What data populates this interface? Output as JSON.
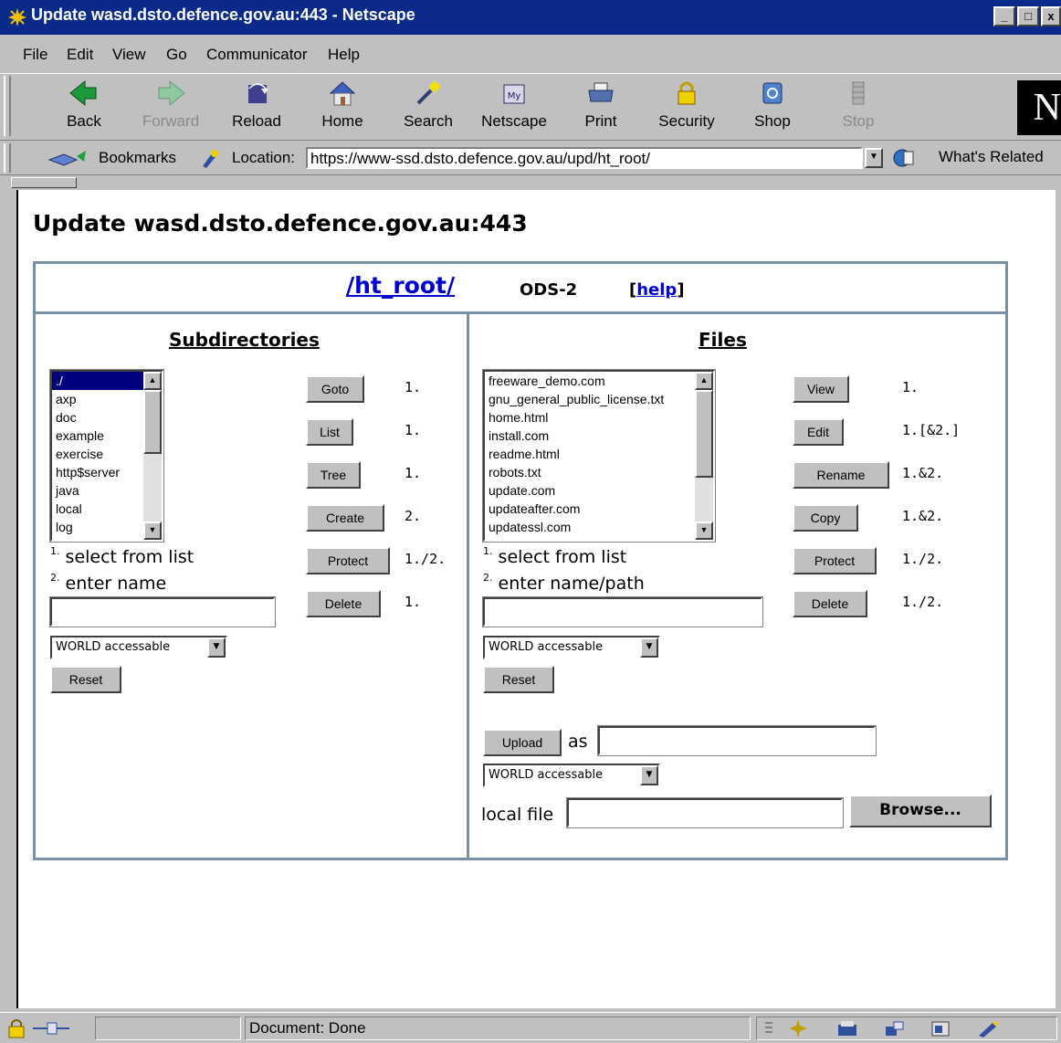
{
  "window": {
    "title": "Update wasd.dsto.defence.gov.au:443 - Netscape",
    "controls": [
      "_",
      "□",
      "x"
    ]
  },
  "menu": {
    "items": [
      {
        "label": "File"
      },
      {
        "label": "Edit"
      },
      {
        "label": "View"
      },
      {
        "label": "Go"
      },
      {
        "label": "Communicator"
      },
      {
        "label": "Help"
      }
    ]
  },
  "toolbar": {
    "buttons": [
      {
        "label": "Back",
        "icon": "back-arrow-icon"
      },
      {
        "label": "Forward",
        "icon": "forward-arrow-icon",
        "disabled": true
      },
      {
        "label": "Reload",
        "icon": "reload-icon"
      },
      {
        "label": "Home",
        "icon": "home-icon"
      },
      {
        "label": "Search",
        "icon": "search-icon"
      },
      {
        "label": "Netscape",
        "icon": "netscape-icon"
      },
      {
        "label": "Print",
        "icon": "print-icon"
      },
      {
        "label": "Security",
        "icon": "lock-icon"
      },
      {
        "label": "Shop",
        "icon": "shop-icon"
      },
      {
        "label": "Stop",
        "icon": "stop-icon",
        "disabled": true
      }
    ],
    "brand_letter": "N"
  },
  "location_bar": {
    "bookmarks_label": "Bookmarks",
    "location_label": "Location:",
    "url": "https://www-ssd.dsto.defence.gov.au/upd/ht_root/",
    "whats_related_label": "What's Related"
  },
  "page": {
    "heading": "Update wasd.dsto.defence.gov.au:443",
    "path_link": "/ht_root/",
    "fs_type": "ODS-2",
    "help_open": "[",
    "help_link": "help",
    "help_close": "]"
  },
  "subdirectories": {
    "title": "Subdirectories",
    "items": [
      "./",
      "axp",
      "doc",
      "example",
      "exercise",
      "http$server",
      "java",
      "local",
      "log"
    ],
    "selected_index": 0,
    "buttons": [
      {
        "label": "Goto",
        "note": "1."
      },
      {
        "label": "List",
        "note": "1."
      },
      {
        "label": "Tree",
        "note": "1."
      },
      {
        "label": "Create",
        "note": "2."
      },
      {
        "label": "Protect",
        "note": "1./2."
      },
      {
        "label": "Delete",
        "note": "1."
      }
    ],
    "hint1_num": "1.",
    "hint1": "select from list",
    "hint2_num": "2.",
    "hint2": "enter name",
    "name_value": "",
    "protection": "WORLD accessable",
    "reset_label": "Reset"
  },
  "files": {
    "title": "Files",
    "items": [
      "freeware_demo.com",
      "gnu_general_public_license.txt",
      "home.html",
      "install.com",
      "readme.html",
      "robots.txt",
      "update.com",
      "updateafter.com",
      "updatessl.com"
    ],
    "buttons": [
      {
        "label": "View",
        "note": "1."
      },
      {
        "label": "Edit",
        "note": "1.[&2.]"
      },
      {
        "label": "Rename",
        "note": "1.&2."
      },
      {
        "label": "Copy",
        "note": "1.&2."
      },
      {
        "label": "Protect",
        "note": "1./2."
      },
      {
        "label": "Delete",
        "note": "1./2."
      }
    ],
    "hint1_num": "1.",
    "hint1": "select from list",
    "hint2_num": "2.",
    "hint2": "enter name/path",
    "name_value": "",
    "protection": "WORLD accessable",
    "reset_label": "Reset",
    "upload_label": "Upload",
    "as_label": "as",
    "upload_as_value": "",
    "upload_protection": "WORLD accessable",
    "local_file_label": "local file",
    "local_file_value": "",
    "browse_label": "Browse..."
  },
  "status": {
    "text": "Document: Done"
  }
}
